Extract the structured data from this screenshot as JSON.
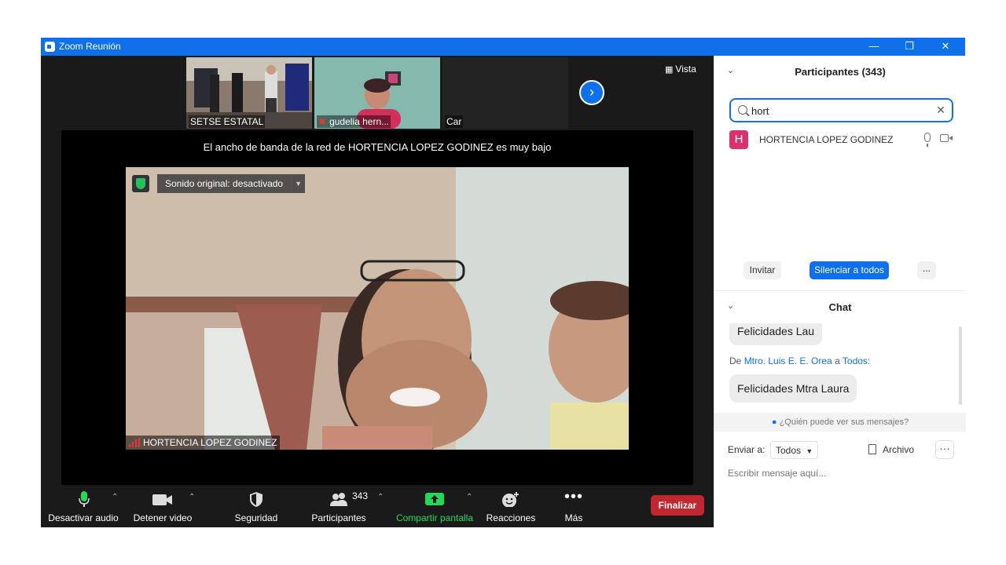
{
  "window": {
    "title": "Zoom Reunión"
  },
  "thumbnails": [
    {
      "label": "SETSE ESTATAL",
      "muted": false
    },
    {
      "label": "gudelia hern...",
      "muted": true
    },
    {
      "label": "Car",
      "muted": false
    }
  ],
  "view_label": "Vista",
  "bandwidth_message": "El ancho de banda de la red de HORTENCIA LOPEZ GODINEZ es muy bajo",
  "main_video": {
    "original_sound_label": "Sonido original: desactivado",
    "participant_name": "HORTENCIA LOPEZ GODINEZ"
  },
  "toolbar": {
    "audio": "Desactivar audio",
    "video": "Detener video",
    "security": "Seguridad",
    "participants": "Participantes",
    "participants_count": "343",
    "share": "Compartir pantalla",
    "reactions": "Reacciones",
    "more": "Más",
    "end": "Finalizar"
  },
  "participants_panel": {
    "title": "Participantes (343)",
    "search_value": "hort",
    "results": [
      {
        "initial": "H",
        "name": "HORTENCIA LOPEZ GODINEZ"
      }
    ],
    "invite": "Invitar",
    "mute_all": "Silenciar a todos",
    "more": "..."
  },
  "chat_panel": {
    "title": "Chat",
    "messages": [
      {
        "text": "Felicidades Lau"
      },
      {
        "from_prefix": "De",
        "sender": "Mtro. Luis E. E. Orea",
        "to_prefix": "a",
        "recipient": "Todos:",
        "text": "Felicidades Mtra Laura"
      }
    ],
    "who_can_see": "¿Quién puede ver sus mensajes?",
    "send_to_label": "Enviar a:",
    "send_to_value": "Todos",
    "file_label": "Archivo",
    "more": "···",
    "input_placeholder": "Escribir mensaje aquí..."
  },
  "colors": {
    "zoom_blue": "#0e71eb",
    "end_red": "#c2262e",
    "share_green": "#1fc35a",
    "avatar_pink": "#d8336f"
  }
}
